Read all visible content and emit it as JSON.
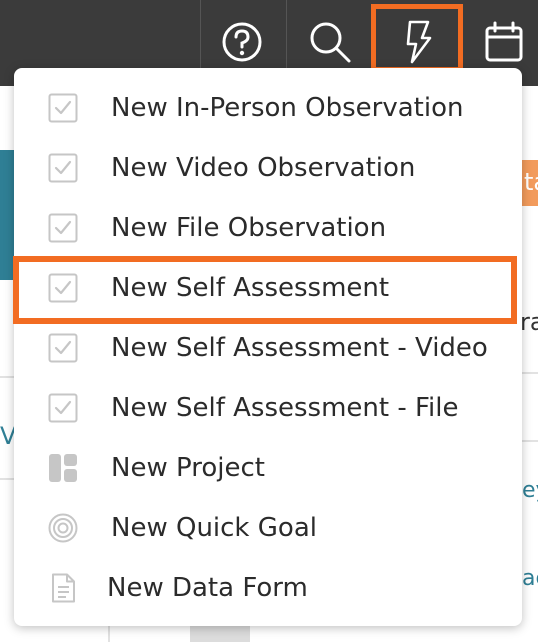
{
  "toolbar": {
    "icons": [
      "help-icon",
      "search-icon",
      "lightning-icon",
      "calendar-icon"
    ],
    "highlight_color": "#f26c22",
    "bar_color": "#3b3b3b"
  },
  "background": {
    "fragment_ra": "ra",
    "fragment_vi": "Vi",
    "fragment_ey": "ey",
    "fragment_ac": "ac",
    "fragment_ta": "ta"
  },
  "menu": {
    "items": [
      {
        "label": "New In-Person Observation",
        "icon": "checkbox-icon"
      },
      {
        "label": "New Video Observation",
        "icon": "checkbox-icon"
      },
      {
        "label": "New File Observation",
        "icon": "checkbox-icon"
      },
      {
        "label": "New Self Assessment",
        "icon": "checkbox-icon"
      },
      {
        "label": "New Self Assessment - Video",
        "icon": "checkbox-icon"
      },
      {
        "label": "New Self Assessment - File",
        "icon": "checkbox-icon"
      },
      {
        "label": "New Project",
        "icon": "project-icon"
      },
      {
        "label": "New Quick Goal",
        "icon": "target-icon"
      },
      {
        "label": "New Data Form",
        "icon": "document-icon"
      }
    ],
    "highlighted_item": "New Self Assessment"
  }
}
